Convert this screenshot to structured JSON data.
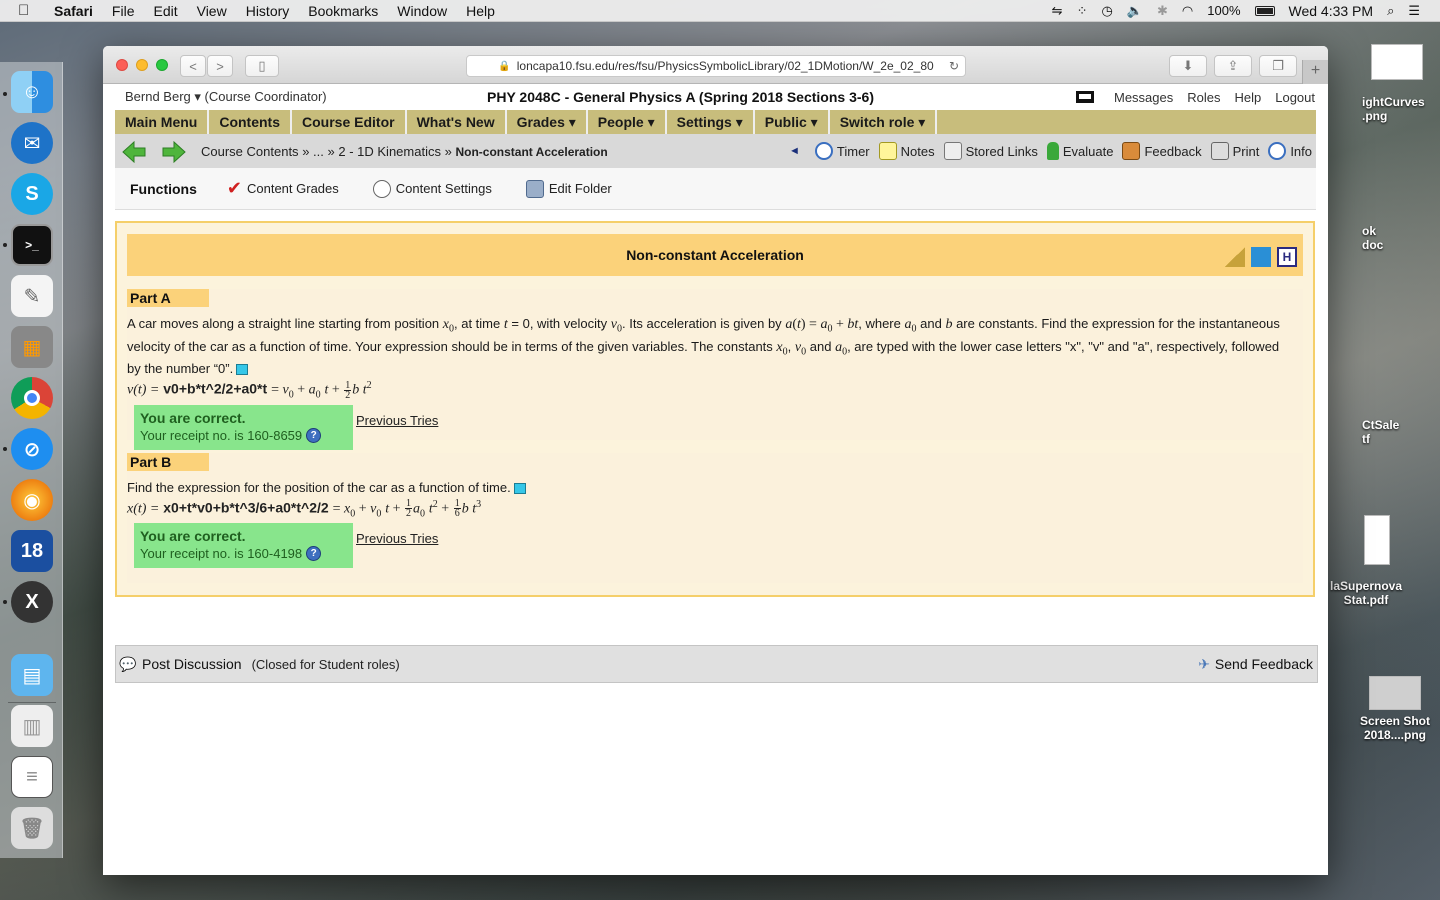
{
  "menubar": {
    "app": "Safari",
    "items": [
      "File",
      "Edit",
      "View",
      "History",
      "Bookmarks",
      "Window",
      "Help"
    ],
    "battery": "100%",
    "clock": "Wed 4:33 PM"
  },
  "desktop": {
    "files": [
      "ightCurves\n.png",
      "ok\ndoc",
      "CtSale\ntf",
      "laSupernova\nStat.pdf",
      "Screen Shot\n2018....png"
    ]
  },
  "browser": {
    "url": "loncapa10.fsu.edu/res/fsu/PhysicsSymbolicLibrary/02_1DMotion/W_2e_02_80"
  },
  "userbar": {
    "user": "Bernd Berg ▾",
    "role": "(Course Coordinator)",
    "course": "PHY 2048C - General Physics A (Spring 2018 Sections 3-6)",
    "links": [
      "Messages",
      "Roles",
      "Help",
      "Logout"
    ]
  },
  "mainnav": {
    "items": [
      "Main Menu",
      "Contents",
      "Course Editor",
      "What's New",
      "Grades ▾",
      "People ▾",
      "Settings ▾",
      "Public ▾",
      "Switch role ▾"
    ]
  },
  "breadcrumb": {
    "part1": "Course Contents",
    "sep": "»",
    "part2": "...",
    "part3": "2 - 1D Kinematics",
    "current": "Non-constant Acceleration"
  },
  "tools": {
    "back_arrow": "◄",
    "items": [
      "Timer",
      "Notes",
      "Stored Links",
      "Evaluate",
      "Feedback",
      "Print",
      "Info"
    ]
  },
  "functions": {
    "title": "Functions",
    "items": [
      "Content Grades",
      "Content Settings",
      "Edit Folder"
    ]
  },
  "problem": {
    "title": "Non-constant Acceleration",
    "partA": {
      "label": "Part A",
      "text_1": "A car moves along a straight line starting from position",
      "text_2": ", at time",
      "text_3": "= 0, with velocity",
      "text_4": ". Its acceleration is given by",
      "text_5": ", where",
      "text_6": "and",
      "text_7": "are constants. Find the expression for the instantaneous velocity of the car as a function of time. Your expression should be in terms of the given variables. The constants",
      "text_8": ",",
      "text_9": "and",
      "text_10": ", are typed with the lower case letters \"x\", \"v\" and \"a\", respectively, followed by the number “0”.",
      "answer_lhs": "v(t) =",
      "answer_input": "v0+b*t^2/2+a0*t",
      "status": "You are correct.",
      "receipt": "Your receipt no. is 160-8659",
      "previous": "Previous Tries"
    },
    "partB": {
      "label": "Part B",
      "text": "Find the expression for the position of the car as a function of time.",
      "answer_lhs": "x(t) =",
      "answer_input": "x0+t*v0+b*t^3/6+a0*t^2/2",
      "status": "You are correct.",
      "receipt": "Your receipt no. is 160-4198",
      "previous": "Previous Tries"
    }
  },
  "discussion": {
    "post": "Post Discussion",
    "closed": "(Closed for Student roles)",
    "send": "Send Feedback"
  },
  "colors": {
    "nav_bg": "#c8bd7c",
    "problem_bg": "#fcf3dc",
    "header_bg": "#fbd27a",
    "correct_bg": "#88e58c"
  }
}
